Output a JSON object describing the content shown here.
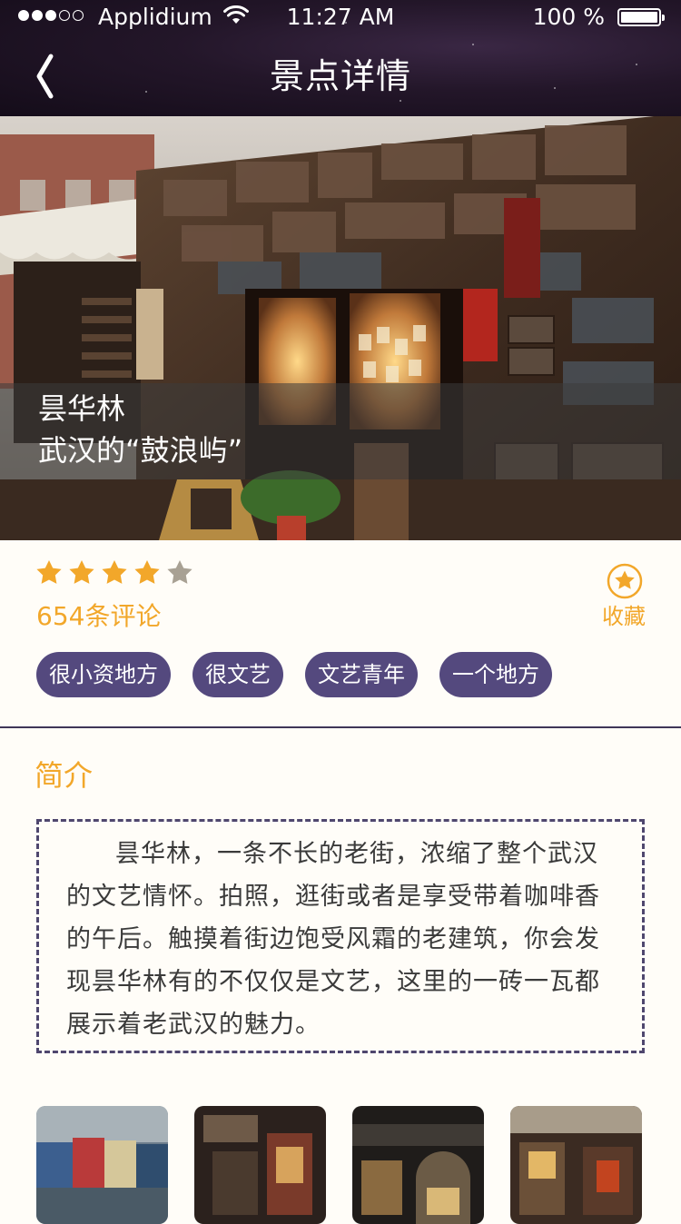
{
  "status_bar": {
    "carrier": "Applidium",
    "time": "11:27 AM",
    "battery": "100 %",
    "signal_bars_filled": 3,
    "signal_bars_total": 5
  },
  "nav": {
    "back_icon": "chevron-left-icon",
    "title": "景点详情"
  },
  "hero": {
    "title": "昙华林",
    "subtitle": "武汉的“鼓浪屿”"
  },
  "rating": {
    "stars": 4,
    "max_stars": 5,
    "star_color": "#f2a72a",
    "empty_star_color": "#a8a194",
    "review_count": "654条评论"
  },
  "favorite": {
    "icon": "star-circle-icon",
    "label": "收藏"
  },
  "tags": [
    "很小资地方",
    "很文艺",
    "文艺青年",
    "一个地方"
  ],
  "intro": {
    "title": "简介",
    "text": "昙华林，一条不长的老街，浓缩了整个武汉的文艺情怀。拍照，逛街或者是享受带着咖啡香的午后。触摸着街边饱受风霜的老建筑，你会发现昙华林有的不仅仅是文艺，这里的一砖一瓦都展示着老武汉的魅力。"
  },
  "colors": {
    "accent": "#f2a72a",
    "tag_bg": "#54497e",
    "header_bg": "#231629",
    "page_bg": "#fffdf8"
  }
}
